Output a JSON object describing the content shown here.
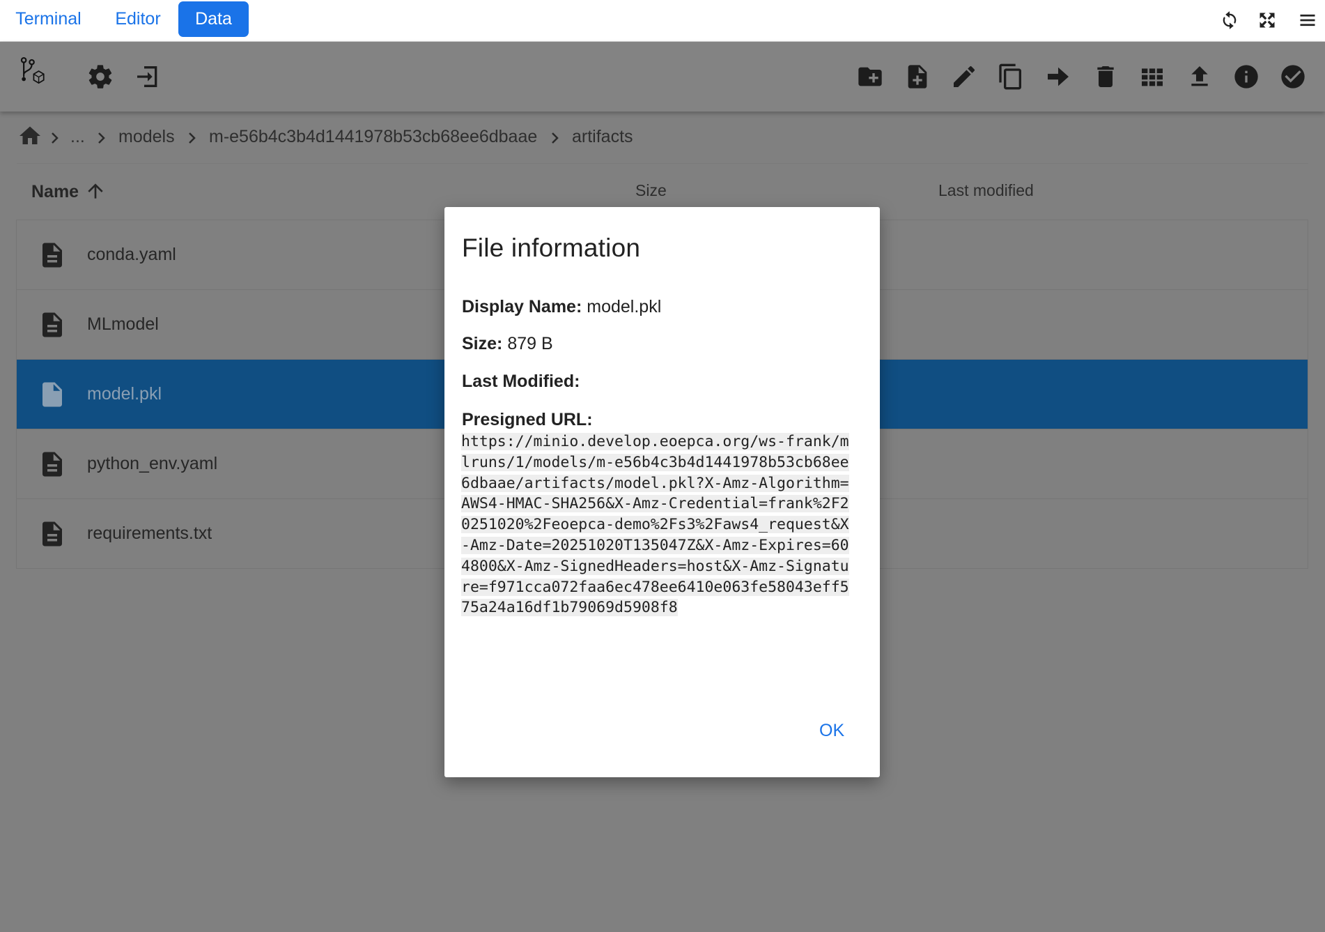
{
  "tabs": [
    {
      "label": "Terminal",
      "active": false
    },
    {
      "label": "Editor",
      "active": false
    },
    {
      "label": "Data",
      "active": true
    }
  ],
  "top_icons": [
    "refresh-icon",
    "fullscreen-icon",
    "menu-icon"
  ],
  "toolbar": {
    "left": [
      "git-models-icon",
      "gear-icon",
      "logout-icon"
    ],
    "right": [
      "new-folder-icon",
      "new-file-icon",
      "rename-icon",
      "copy-icon",
      "move-icon",
      "delete-icon",
      "grid-view-icon",
      "upload-icon",
      "info-icon",
      "select-check-icon"
    ]
  },
  "breadcrumb": {
    "home_icon": "home-icon",
    "items": [
      "...",
      "models",
      "m-e56b4c3b4d1441978b53cb68ee6dbaae",
      "artifacts"
    ]
  },
  "table": {
    "columns": {
      "name": "Name",
      "size": "Size",
      "modified": "Last modified"
    },
    "sort_icon": "arrow-up-icon",
    "rows": [
      {
        "name": "conda.yaml",
        "selected": false
      },
      {
        "name": "MLmodel",
        "selected": false
      },
      {
        "name": "model.pkl",
        "selected": true
      },
      {
        "name": "python_env.yaml",
        "selected": false
      },
      {
        "name": "requirements.txt",
        "selected": false
      }
    ]
  },
  "dialog": {
    "title": "File information",
    "display_name_label": "Display Name:",
    "display_name": "model.pkl",
    "size_label": "Size:",
    "size": "879 B",
    "last_modified_label": "Last Modified:",
    "last_modified": "",
    "url_label": "Presigned URL:",
    "url": "https://minio.develop.eoepca.org/ws-frank/mlruns/1/models/m-e56b4c3b4d1441978b53cb68ee6dbaae/artifacts/model.pkl?X-Amz-Algorithm=AWS4-HMAC-SHA256&X-Amz-Credential=frank%2F20251020%2Feoepca-demo%2Fs3%2Faws4_request&X-Amz-Date=20251020T135047Z&X-Amz-Expires=604800&X-Amz-SignedHeaders=host&X-Amz-Signature=f971cca072faa6ec478ee6410e063fe58043eff575a24a16df1b79069d5908f8",
    "ok_label": "OK"
  },
  "colors": {
    "accent": "#1a73e8",
    "selected_row": "#104e82",
    "overlay_bg": "#808080"
  }
}
